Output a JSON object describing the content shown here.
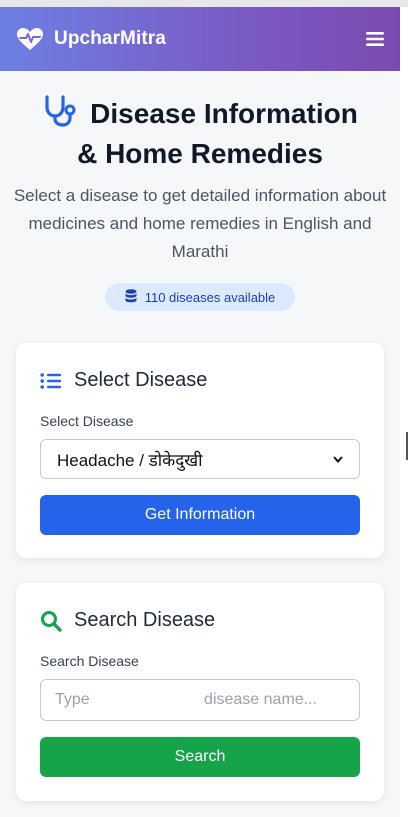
{
  "navbar": {
    "brand": "UpcharMitra",
    "brand_icon": "heart-pulse-icon",
    "menu_icon": "hamburger-menu-icon",
    "gradient": [
      "#6d7fe3",
      "#7b4bb0"
    ]
  },
  "hero": {
    "title_line1": "Disease Information",
    "title_line2": "& Home Remedies",
    "title_icon": "stethoscope-icon",
    "subtitle": "Select a disease to get detailed information about medicines and home remedies in English and Marathi"
  },
  "badge": {
    "icon": "database-icon",
    "text": "110 diseases available"
  },
  "select_card": {
    "title": "Select Disease",
    "icon": "list-icon",
    "label": "Select Disease",
    "selected_value": "Headache / डोकेदुखी",
    "button_label": "Get Information",
    "button_color": "#2563eb"
  },
  "search_card": {
    "title": "Search Disease",
    "icon": "search-icon",
    "label": "Search Disease",
    "placeholder_part1": "Type",
    "placeholder_part2": "disease name...",
    "button_label": "Search",
    "button_color": "#16a34a"
  }
}
